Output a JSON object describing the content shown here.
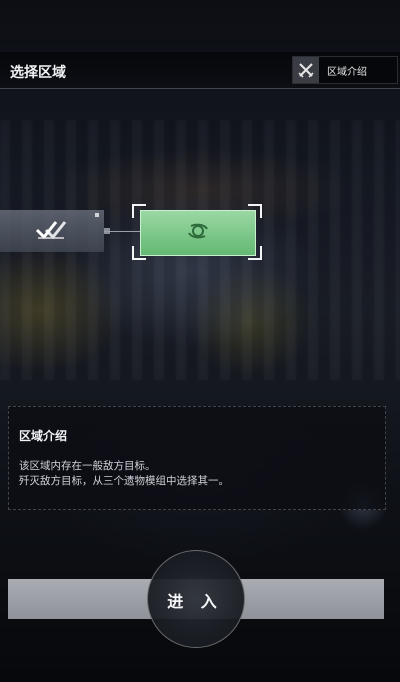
{
  "header": {
    "title": "选择区域",
    "intro_button_label": "区域介绍"
  },
  "map": {
    "left_node_status": "completed",
    "selected_node_status": "selected"
  },
  "info_panel": {
    "title": "区域介绍",
    "lines": [
      "该区域内存在一般敌方目标。",
      "歼灭敌方目标，从三个遗物模组中选择其一。"
    ]
  },
  "action": {
    "enter_label": "进 入"
  },
  "colors": {
    "accent_green": "#7cc88a",
    "button_gray": "#9a9ea4"
  }
}
